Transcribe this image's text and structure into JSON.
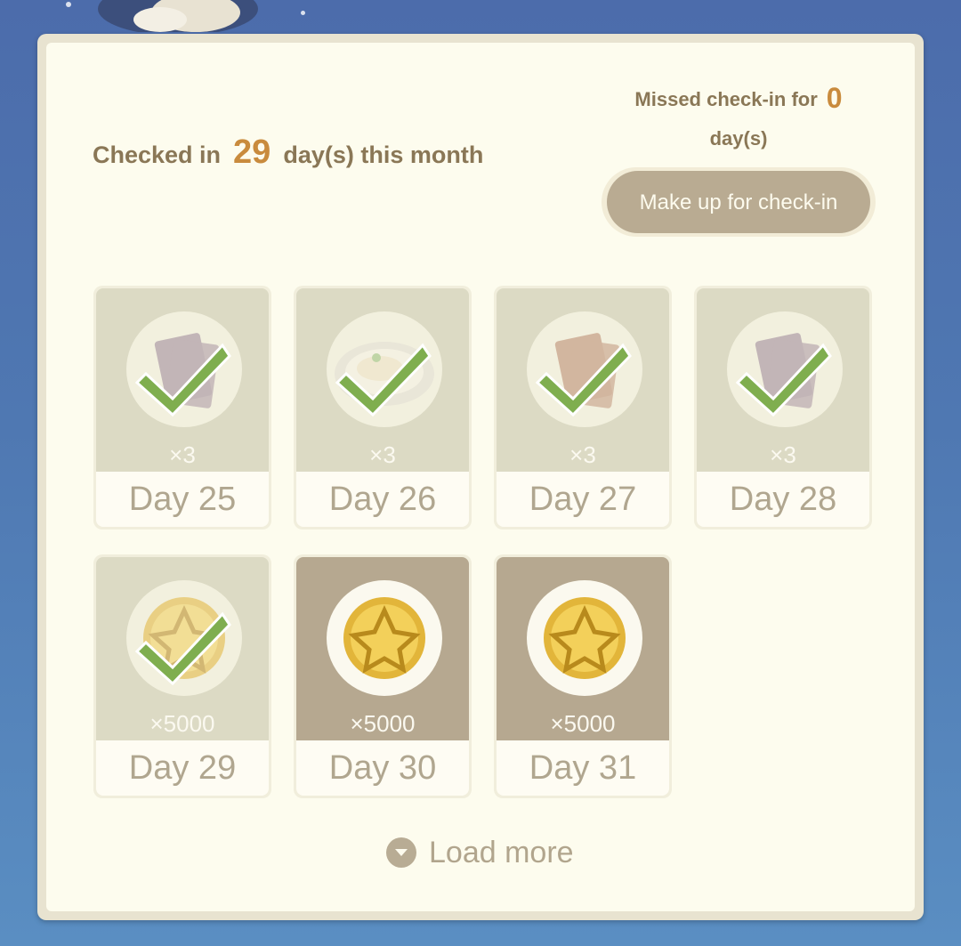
{
  "header": {
    "checked_prefix": "Checked in",
    "checked_count": "29",
    "checked_suffix": "day(s) this month",
    "missed_prefix": "Missed check-in for",
    "missed_count": "0",
    "missed_suffix": "day(s)",
    "makeup_label": "Make up for check-in"
  },
  "rewards": [
    {
      "day": "Day 25",
      "qty": "×3",
      "item": "card-stack-purple-icon",
      "claimed": true
    },
    {
      "day": "Day 26",
      "qty": "×3",
      "item": "food-plate-icon",
      "claimed": true
    },
    {
      "day": "Day 27",
      "qty": "×3",
      "item": "card-stack-red-icon",
      "claimed": true
    },
    {
      "day": "Day 28",
      "qty": "×3",
      "item": "card-stack-purple-icon",
      "claimed": true
    },
    {
      "day": "Day 29",
      "qty": "×5000",
      "item": "gold-coin-icon",
      "claimed": true
    },
    {
      "day": "Day 30",
      "qty": "×5000",
      "item": "gold-coin-icon",
      "claimed": false
    },
    {
      "day": "Day 31",
      "qty": "×5000",
      "item": "gold-coin-icon",
      "claimed": false
    }
  ],
  "footer": {
    "load_more_label": "Load more"
  },
  "colors": {
    "accent": "#c98b3d",
    "label": "#8a7756",
    "checkmark": "#7fae4f"
  }
}
